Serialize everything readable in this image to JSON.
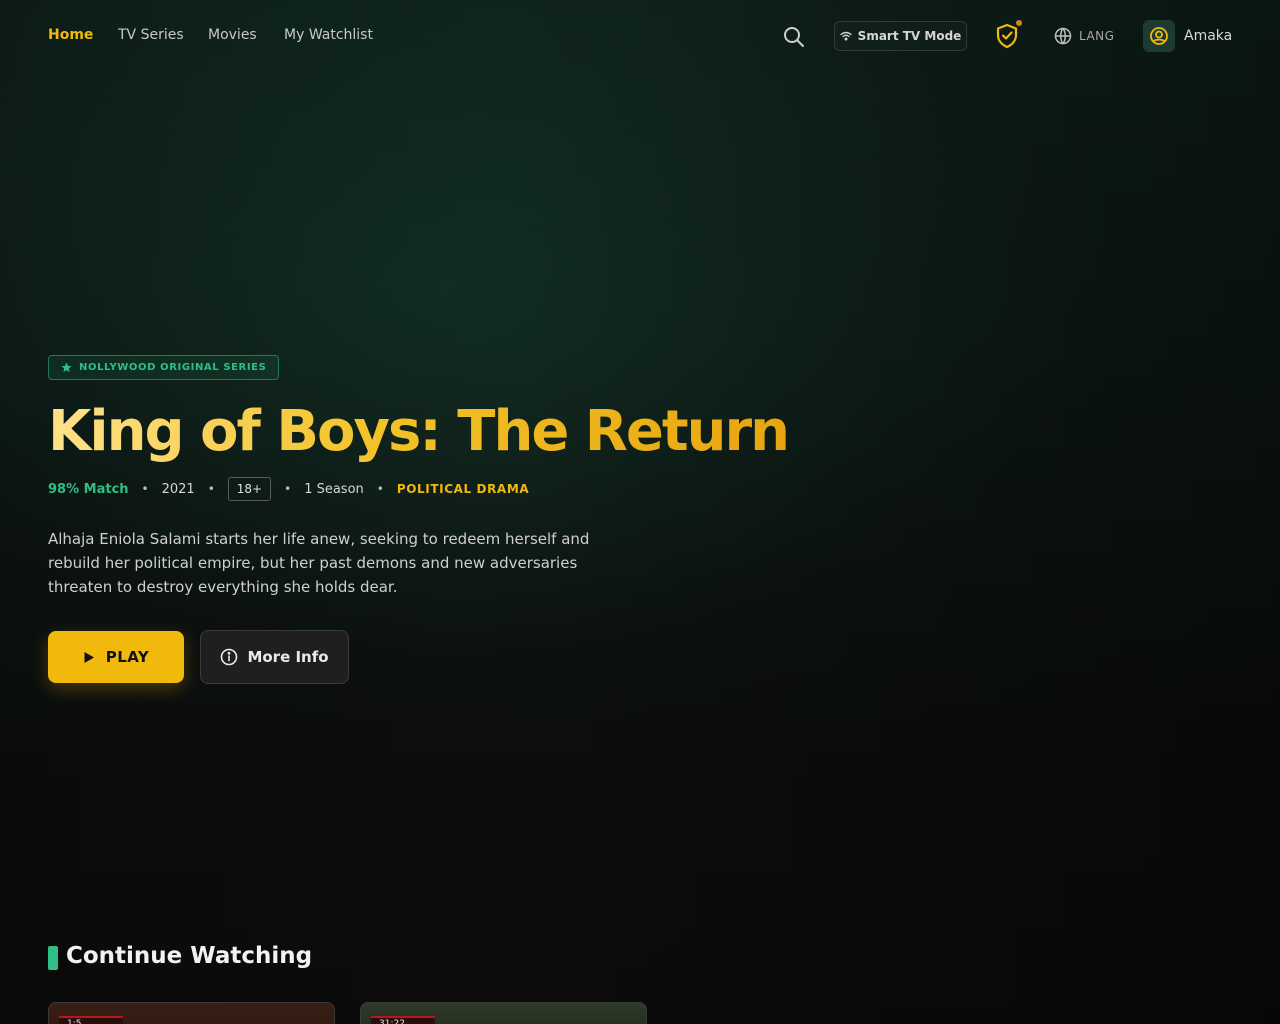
{
  "nav": {
    "links": [
      {
        "label": "Home",
        "active": true
      },
      {
        "label": "TV Series",
        "active": false
      },
      {
        "label": "Movies",
        "active": false
      },
      {
        "label": "My Watchlist",
        "active": false
      }
    ],
    "search_icon": "search-icon",
    "tv_mode_label": "Smart TV Mode",
    "tv_mode_icon": "wifi-icon",
    "shield_icon": "shield-check-icon",
    "lang_label": "LANG",
    "lang_icon": "language-icon",
    "profile_name": "Amaka",
    "profile_icon": "user-icon"
  },
  "hero": {
    "badge": "NOLLYWOOD ORIGINAL SERIES",
    "badge_icon": "star-icon",
    "title": "King of Boys: The Return",
    "match": "98% Match",
    "year": "2021",
    "rating": "18+",
    "seasons": "1 Season",
    "genre": "POLITICAL DRAMA",
    "description": "Alhaja Eniola Salami starts her life anew, seeking to redeem herself and rebuild her political empire, but her past demons and new adversaries threaten to destroy everything she holds dear.",
    "play_label": "PLAY",
    "info_label": "More Info"
  },
  "continue_watching": {
    "title": "Continue Watching",
    "cards": [
      {
        "tag": "1:5"
      },
      {
        "tag": "31:22"
      }
    ]
  },
  "colors": {
    "accent": "#f0b90b",
    "green": "#2fbf86",
    "background": "#0d0d0d"
  }
}
